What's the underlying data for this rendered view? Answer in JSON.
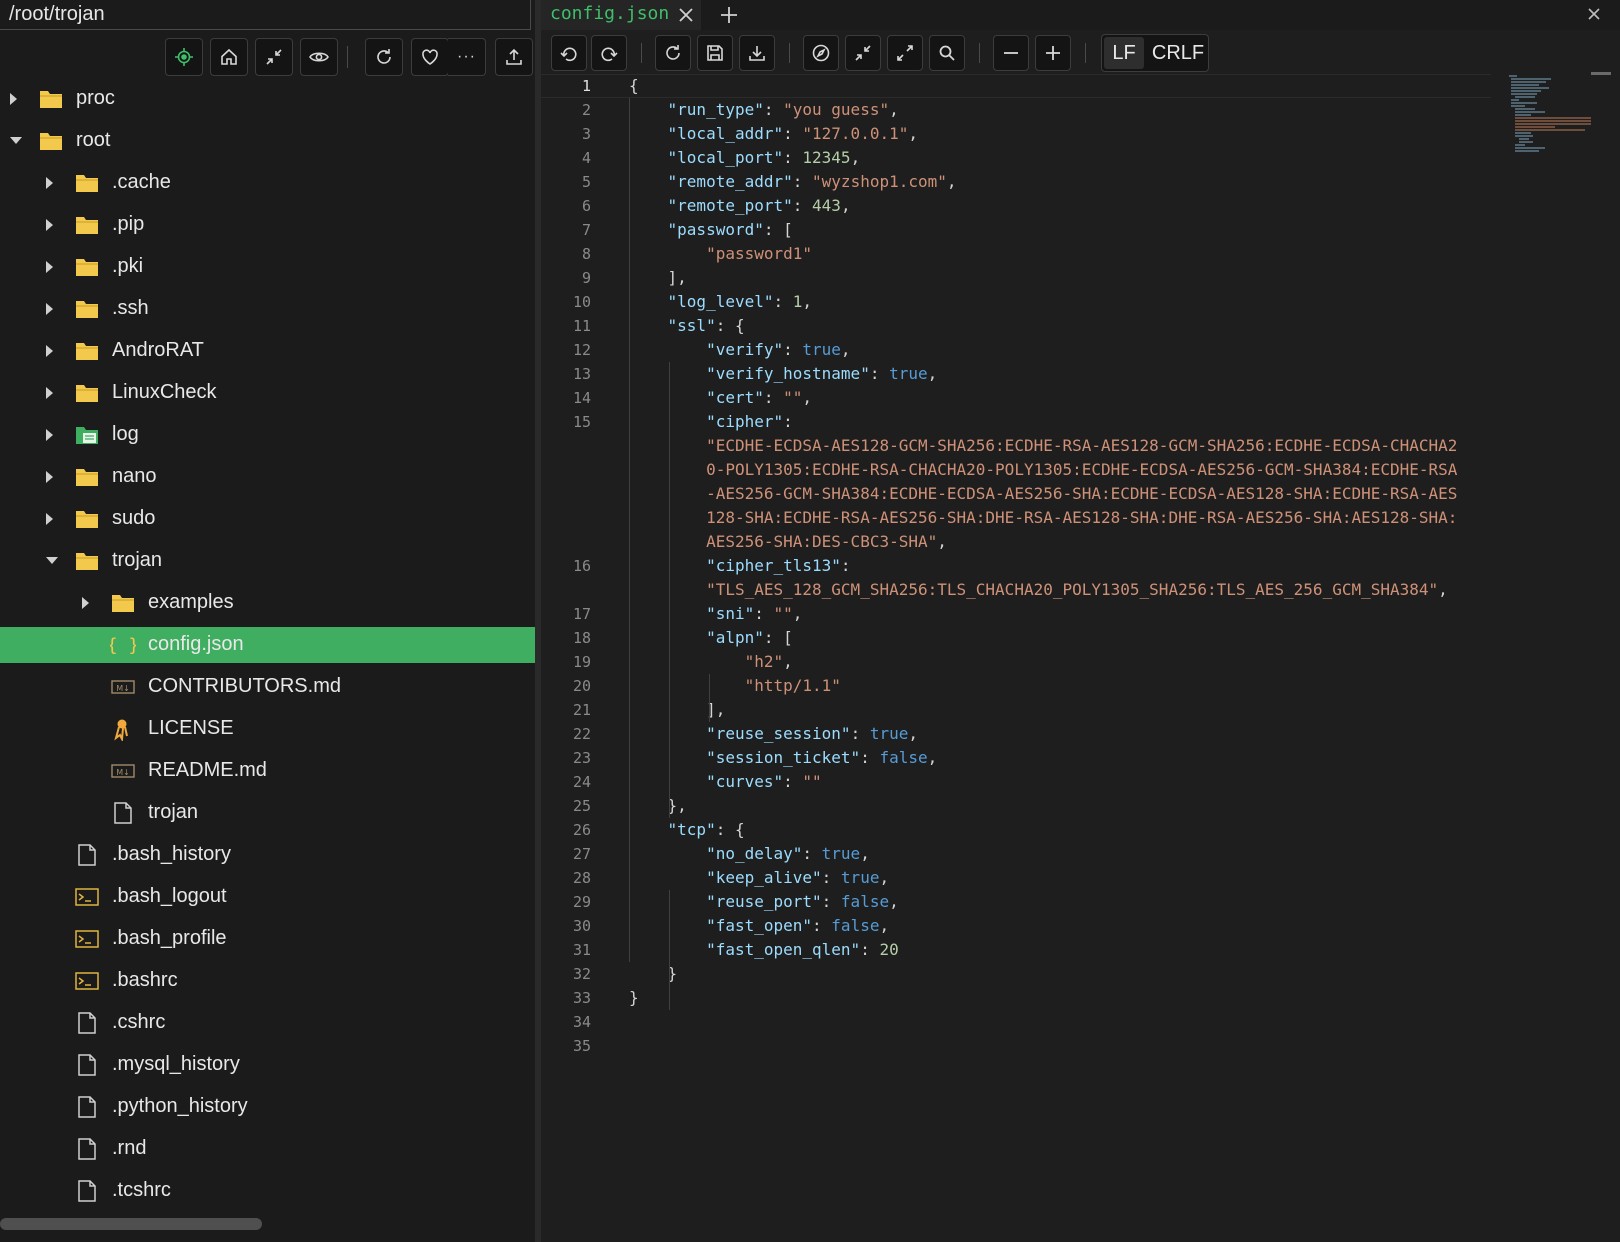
{
  "sidebar": {
    "path": "/root/trojan",
    "toolbar": [
      "locate-icon",
      "home-icon",
      "collapse-icon",
      "eye-icon",
      "refresh-icon",
      "heart-icon",
      "more-icon",
      "upload-icon"
    ],
    "more_label": "···",
    "items": [
      {
        "label": "proc",
        "depth": 0,
        "type": "folder",
        "state": "collapsed"
      },
      {
        "label": "root",
        "depth": 0,
        "type": "folder",
        "state": "expanded"
      },
      {
        "label": ".cache",
        "depth": 1,
        "type": "folder",
        "state": "collapsed"
      },
      {
        "label": ".pip",
        "depth": 1,
        "type": "folder",
        "state": "collapsed"
      },
      {
        "label": ".pki",
        "depth": 1,
        "type": "folder",
        "state": "collapsed"
      },
      {
        "label": ".ssh",
        "depth": 1,
        "type": "folder",
        "state": "collapsed"
      },
      {
        "label": "AndroRAT",
        "depth": 1,
        "type": "folder",
        "state": "collapsed"
      },
      {
        "label": "LinuxCheck",
        "depth": 1,
        "type": "folder",
        "state": "collapsed"
      },
      {
        "label": "log",
        "depth": 1,
        "type": "log-folder",
        "state": "collapsed"
      },
      {
        "label": "nano",
        "depth": 1,
        "type": "folder",
        "state": "collapsed"
      },
      {
        "label": "sudo",
        "depth": 1,
        "type": "folder",
        "state": "collapsed"
      },
      {
        "label": "trojan",
        "depth": 1,
        "type": "folder",
        "state": "expanded"
      },
      {
        "label": "examples",
        "depth": 2,
        "type": "folder",
        "state": "collapsed"
      },
      {
        "label": "config.json",
        "depth": 2,
        "type": "json",
        "selected": true
      },
      {
        "label": "CONTRIBUTORS.md",
        "depth": 2,
        "type": "markdown"
      },
      {
        "label": "LICENSE",
        "depth": 2,
        "type": "license"
      },
      {
        "label": "README.md",
        "depth": 2,
        "type": "markdown"
      },
      {
        "label": "trojan",
        "depth": 2,
        "type": "file"
      },
      {
        "label": ".bash_history",
        "depth": 1,
        "type": "file"
      },
      {
        "label": ".bash_logout",
        "depth": 1,
        "type": "shell"
      },
      {
        "label": ".bash_profile",
        "depth": 1,
        "type": "shell"
      },
      {
        "label": ".bashrc",
        "depth": 1,
        "type": "shell"
      },
      {
        "label": ".cshrc",
        "depth": 1,
        "type": "file"
      },
      {
        "label": ".mysql_history",
        "depth": 1,
        "type": "file"
      },
      {
        "label": ".python_history",
        "depth": 1,
        "type": "file"
      },
      {
        "label": ".rnd",
        "depth": 1,
        "type": "file"
      },
      {
        "label": ".tcshrc",
        "depth": 1,
        "type": "file"
      }
    ]
  },
  "editor": {
    "tab_label": "config.json",
    "eol": {
      "lf": "LF",
      "crlf": "CRLF",
      "selected": "LF"
    },
    "toolbar": [
      "undo-icon",
      "redo-icon",
      "reload-icon",
      "save-icon",
      "download-icon",
      "compass-icon",
      "collapse-icon",
      "expand-icon",
      "search-icon",
      "zoom-out-icon",
      "zoom-in-icon"
    ],
    "current_line": 1,
    "line_count": 35,
    "lines": [
      {
        "n": 1,
        "t": [
          [
            "p",
            "{"
          ]
        ]
      },
      {
        "n": 2,
        "t": [
          [
            "p",
            "    "
          ],
          [
            "k",
            "\"run_type\""
          ],
          [
            "p",
            ": "
          ],
          [
            "s",
            "\"you guess\""
          ],
          [
            "p",
            ","
          ]
        ]
      },
      {
        "n": 3,
        "t": [
          [
            "p",
            "    "
          ],
          [
            "k",
            "\"local_addr\""
          ],
          [
            "p",
            ": "
          ],
          [
            "s",
            "\"127.0.0.1\""
          ],
          [
            "p",
            ","
          ]
        ]
      },
      {
        "n": 4,
        "t": [
          [
            "p",
            "    "
          ],
          [
            "k",
            "\"local_port\""
          ],
          [
            "p",
            ": "
          ],
          [
            "n",
            "12345"
          ],
          [
            "p",
            ","
          ]
        ]
      },
      {
        "n": 5,
        "t": [
          [
            "p",
            "    "
          ],
          [
            "k",
            "\"remote_addr\""
          ],
          [
            "p",
            ": "
          ],
          [
            "s",
            "\"wyzshop1.com\""
          ],
          [
            "p",
            ","
          ]
        ]
      },
      {
        "n": 6,
        "t": [
          [
            "p",
            "    "
          ],
          [
            "k",
            "\"remote_port\""
          ],
          [
            "p",
            ": "
          ],
          [
            "n",
            "443"
          ],
          [
            "p",
            ","
          ]
        ]
      },
      {
        "n": 7,
        "t": [
          [
            "p",
            "    "
          ],
          [
            "k",
            "\"password\""
          ],
          [
            "p",
            ": ["
          ]
        ]
      },
      {
        "n": 8,
        "t": [
          [
            "p",
            "        "
          ],
          [
            "s",
            "\"password1\""
          ]
        ]
      },
      {
        "n": 9,
        "t": [
          [
            "p",
            "    ],"
          ]
        ]
      },
      {
        "n": 10,
        "t": [
          [
            "p",
            "    "
          ],
          [
            "k",
            "\"log_level\""
          ],
          [
            "p",
            ": "
          ],
          [
            "n",
            "1"
          ],
          [
            "p",
            ","
          ]
        ]
      },
      {
        "n": 11,
        "t": [
          [
            "p",
            "    "
          ],
          [
            "k",
            "\"ssl\""
          ],
          [
            "p",
            ": {"
          ]
        ]
      },
      {
        "n": 12,
        "t": [
          [
            "p",
            "        "
          ],
          [
            "k",
            "\"verify\""
          ],
          [
            "p",
            ": "
          ],
          [
            "b",
            "true"
          ],
          [
            "p",
            ","
          ]
        ]
      },
      {
        "n": 13,
        "t": [
          [
            "p",
            "        "
          ],
          [
            "k",
            "\"verify_hostname\""
          ],
          [
            "p",
            ": "
          ],
          [
            "b",
            "true"
          ],
          [
            "p",
            ","
          ]
        ]
      },
      {
        "n": 14,
        "t": [
          [
            "p",
            "        "
          ],
          [
            "k",
            "\"cert\""
          ],
          [
            "p",
            ": "
          ],
          [
            "s",
            "\"\""
          ],
          [
            "p",
            ","
          ]
        ]
      },
      {
        "n": 15,
        "t": [
          [
            "p",
            "        "
          ],
          [
            "k",
            "\"cipher\""
          ],
          [
            "p",
            ":"
          ]
        ]
      },
      {
        "n": null,
        "t": [
          [
            "p",
            "        "
          ],
          [
            "s",
            "\"ECDHE-ECDSA-AES128-GCM-SHA256:ECDHE-RSA-AES128-GCM-SHA256:ECDHE-ECDSA-CHACHA2"
          ]
        ]
      },
      {
        "n": null,
        "t": [
          [
            "p",
            "        "
          ],
          [
            "s",
            "0-POLY1305:ECDHE-RSA-CHACHA20-POLY1305:ECDHE-ECDSA-AES256-GCM-SHA384:ECDHE-RSA"
          ]
        ]
      },
      {
        "n": null,
        "t": [
          [
            "p",
            "        "
          ],
          [
            "s",
            "-AES256-GCM-SHA384:ECDHE-ECDSA-AES256-SHA:ECDHE-ECDSA-AES128-SHA:ECDHE-RSA-AES"
          ]
        ]
      },
      {
        "n": null,
        "t": [
          [
            "p",
            "        "
          ],
          [
            "s",
            "128-SHA:ECDHE-RSA-AES256-SHA:DHE-RSA-AES128-SHA:DHE-RSA-AES256-SHA:AES128-SHA:"
          ]
        ]
      },
      {
        "n": null,
        "t": [
          [
            "p",
            "        "
          ],
          [
            "s",
            "AES256-SHA:DES-CBC3-SHA\""
          ],
          [
            "p",
            ","
          ]
        ]
      },
      {
        "n": 16,
        "t": [
          [
            "p",
            "        "
          ],
          [
            "k",
            "\"cipher_tls13\""
          ],
          [
            "p",
            ":"
          ]
        ]
      },
      {
        "n": null,
        "t": [
          [
            "p",
            "        "
          ],
          [
            "s",
            "\"TLS_AES_128_GCM_SHA256:TLS_CHACHA20_POLY1305_SHA256:TLS_AES_256_GCM_SHA384\""
          ],
          [
            "p",
            ","
          ]
        ]
      },
      {
        "n": 17,
        "t": [
          [
            "p",
            "        "
          ],
          [
            "k",
            "\"sni\""
          ],
          [
            "p",
            ": "
          ],
          [
            "s",
            "\"\""
          ],
          [
            "p",
            ","
          ]
        ]
      },
      {
        "n": 18,
        "t": [
          [
            "p",
            "        "
          ],
          [
            "k",
            "\"alpn\""
          ],
          [
            "p",
            ": ["
          ]
        ]
      },
      {
        "n": 19,
        "t": [
          [
            "p",
            "            "
          ],
          [
            "s",
            "\"h2\""
          ],
          [
            "p",
            ","
          ]
        ]
      },
      {
        "n": 20,
        "t": [
          [
            "p",
            "            "
          ],
          [
            "s",
            "\"http/1.1\""
          ]
        ]
      },
      {
        "n": 21,
        "t": [
          [
            "p",
            "        ],"
          ]
        ]
      },
      {
        "n": 22,
        "t": [
          [
            "p",
            "        "
          ],
          [
            "k",
            "\"reuse_session\""
          ],
          [
            "p",
            ": "
          ],
          [
            "b",
            "true"
          ],
          [
            "p",
            ","
          ]
        ]
      },
      {
        "n": 23,
        "t": [
          [
            "p",
            "        "
          ],
          [
            "k",
            "\"session_ticket\""
          ],
          [
            "p",
            ": "
          ],
          [
            "b",
            "false"
          ],
          [
            "p",
            ","
          ]
        ]
      },
      {
        "n": 24,
        "t": [
          [
            "p",
            "        "
          ],
          [
            "k",
            "\"curves\""
          ],
          [
            "p",
            ": "
          ],
          [
            "s",
            "\"\""
          ]
        ]
      },
      {
        "n": 25,
        "t": [
          [
            "p",
            "    },"
          ]
        ]
      },
      {
        "n": 26,
        "t": [
          [
            "p",
            "    "
          ],
          [
            "k",
            "\"tcp\""
          ],
          [
            "p",
            ": {"
          ]
        ]
      },
      {
        "n": 27,
        "t": [
          [
            "p",
            "        "
          ],
          [
            "k",
            "\"no_delay\""
          ],
          [
            "p",
            ": "
          ],
          [
            "b",
            "true"
          ],
          [
            "p",
            ","
          ]
        ]
      },
      {
        "n": 28,
        "t": [
          [
            "p",
            "        "
          ],
          [
            "k",
            "\"keep_alive\""
          ],
          [
            "p",
            ": "
          ],
          [
            "b",
            "true"
          ],
          [
            "p",
            ","
          ]
        ]
      },
      {
        "n": 29,
        "t": [
          [
            "p",
            "        "
          ],
          [
            "k",
            "\"reuse_port\""
          ],
          [
            "p",
            ": "
          ],
          [
            "b",
            "false"
          ],
          [
            "p",
            ","
          ]
        ]
      },
      {
        "n": 30,
        "t": [
          [
            "p",
            "        "
          ],
          [
            "k",
            "\"fast_open\""
          ],
          [
            "p",
            ": "
          ],
          [
            "b",
            "false"
          ],
          [
            "p",
            ","
          ]
        ]
      },
      {
        "n": 31,
        "t": [
          [
            "p",
            "        "
          ],
          [
            "k",
            "\"fast_open_qlen\""
          ],
          [
            "p",
            ": "
          ],
          [
            "n",
            "20"
          ]
        ]
      },
      {
        "n": 32,
        "t": [
          [
            "p",
            "    }"
          ]
        ]
      },
      {
        "n": 33,
        "t": [
          [
            "p",
            "}"
          ]
        ]
      },
      {
        "n": 34,
        "t": []
      },
      {
        "n": 35,
        "t": []
      }
    ]
  },
  "colors": {
    "accent": "#3fae61",
    "json_key": "#9cdcfe",
    "json_string": "#ce9178",
    "json_number": "#b5cea8",
    "json_bool": "#569cd6",
    "folder": "#f2c94c"
  }
}
